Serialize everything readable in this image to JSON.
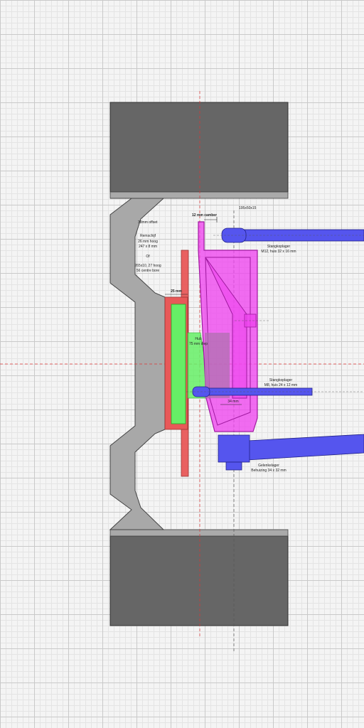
{
  "labels": {
    "offset": "38mm offset",
    "remschijf": [
      "Remschijf",
      "26 mm hoog",
      "247 x 8 mm"
    ],
    "of": "Of",
    "alt_disc": [
      "265x10, 27 hoog",
      "56 centre bore"
    ],
    "camber": "12 mm camber",
    "section": "195x50x15",
    "bearing_top": [
      "Stangkoplager",
      "M12, huis 32 x 16 mm"
    ],
    "hub": [
      "Hub",
      "75 mm diep"
    ],
    "dim_25": "25 mm",
    "bearing_mid": [
      "Stangkoplager",
      "M8, huis 24 x 12 mm"
    ],
    "dim_34": "34 mm",
    "bearing_bottom": [
      "Gelenkelager",
      "Behuizing 34 x 32 mm"
    ]
  },
  "colors": {
    "tyre": "#666666",
    "rim": "#a8a8a8",
    "disc": "#e85858",
    "hub": "#66ee66",
    "upright": "#ee44ee",
    "rod": "#5555ee",
    "centerline": "#dd3333"
  }
}
